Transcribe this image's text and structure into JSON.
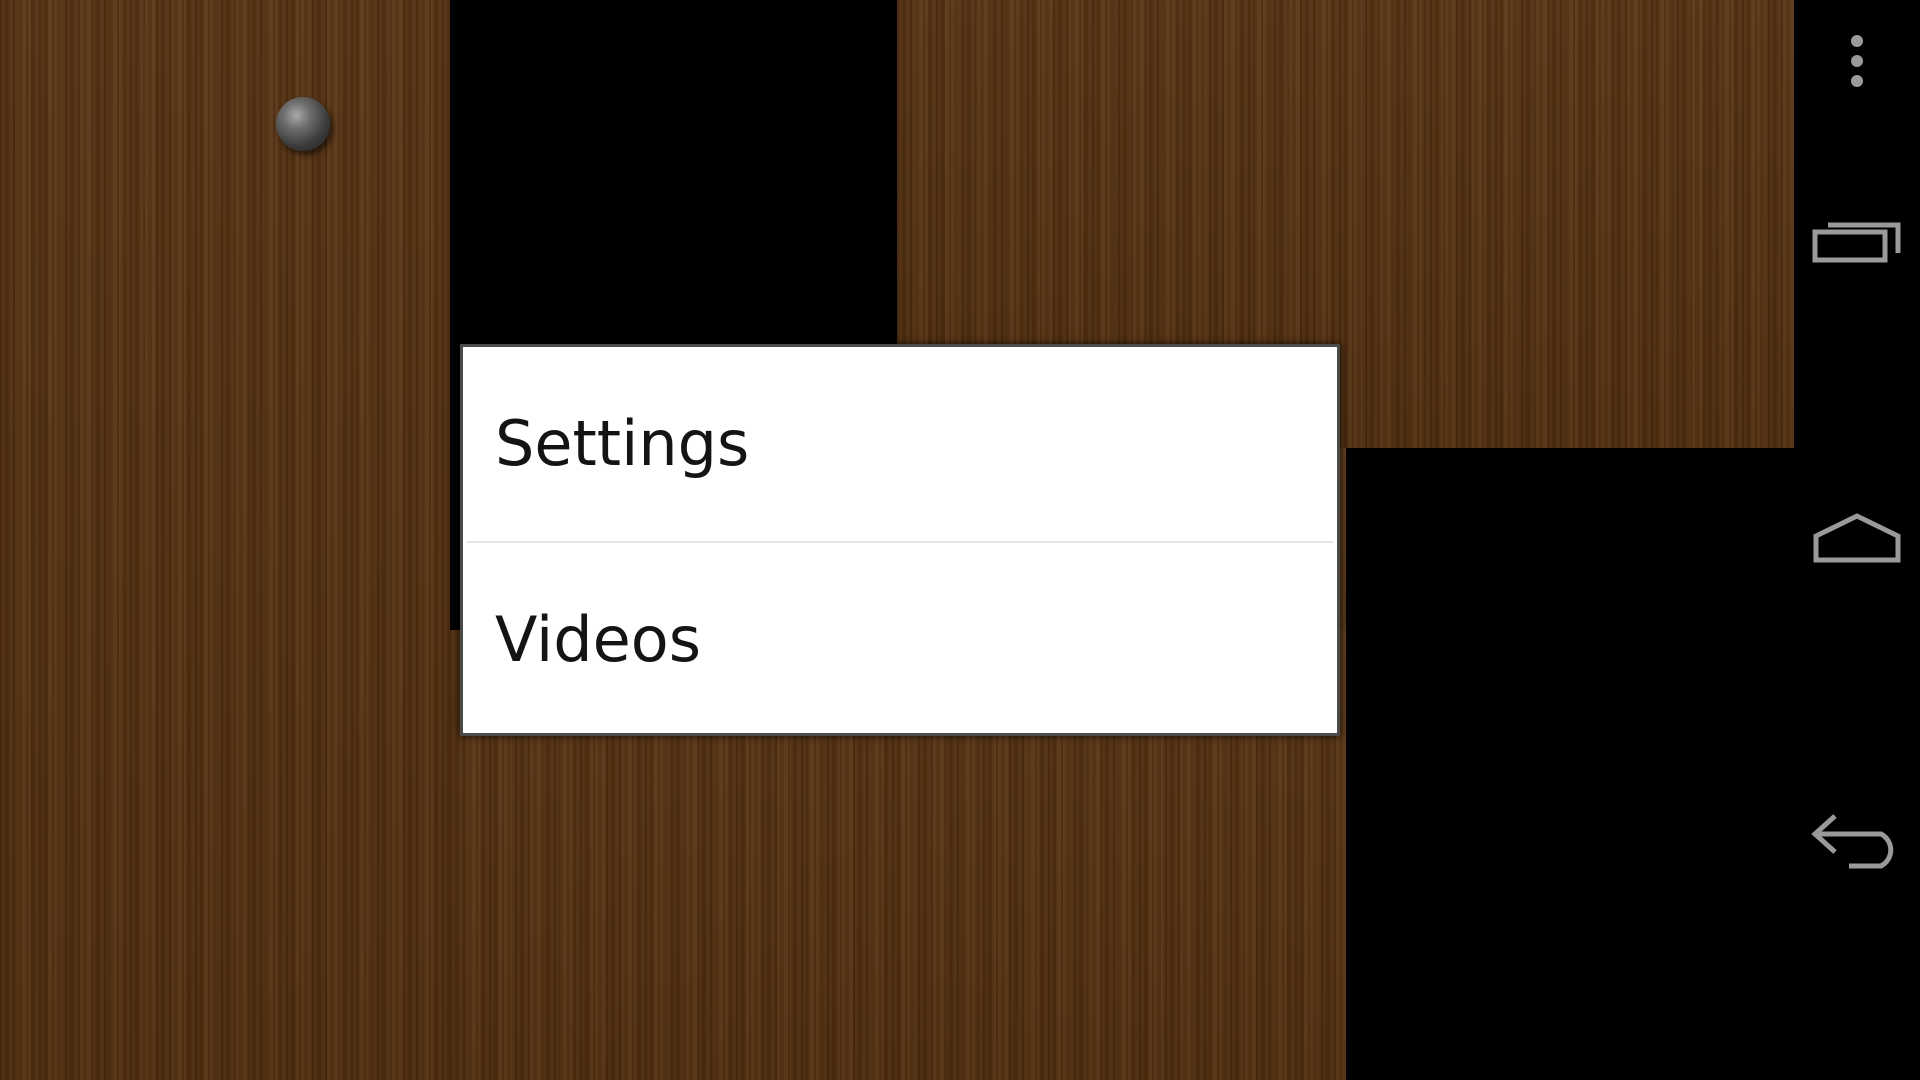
{
  "menu": {
    "items": [
      {
        "label": "Settings"
      },
      {
        "label": "Videos"
      }
    ]
  },
  "navbar": {
    "buttons": [
      "overflow-menu",
      "recent-apps",
      "home",
      "back"
    ]
  },
  "colors": {
    "wood": "#55300f",
    "wall": "#000000",
    "dialog_bg": "#ffffff",
    "dialog_border": "#4a4a4a",
    "nav_icon": "#9a9a9a"
  }
}
